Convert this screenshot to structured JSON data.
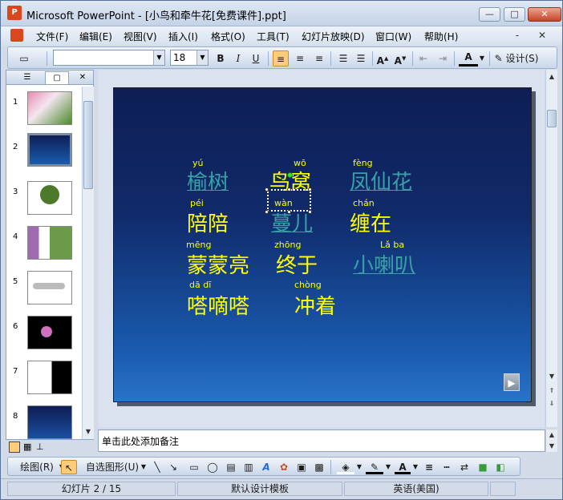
{
  "window": {
    "title": "Microsoft PowerPoint - [小鸟和牵牛花[免费课件].ppt]",
    "min": "—",
    "max": "□",
    "close": "✕"
  },
  "menu": [
    "文件(F)",
    "编辑(E)",
    "视图(V)",
    "插入(I)",
    "格式(O)",
    "工具(T)",
    "幻灯片放映(D)",
    "窗口(W)",
    "帮助(H)"
  ],
  "mdi": "- ✕",
  "toolbar": {
    "font_name": "",
    "font_size": "18",
    "bold": "B",
    "italic": "I",
    "underline": "U",
    "design": "设计(S)",
    "font_color": "A"
  },
  "thumbnails": [
    "1",
    "2",
    "3",
    "4",
    "5",
    "6",
    "7",
    "8"
  ],
  "selected_slide": 2,
  "slide": {
    "words": [
      {
        "text": "榆树",
        "pinyin": "yú",
        "link": true
      },
      {
        "text": "鸟窝",
        "pinyin": "wō",
        "link": false
      },
      {
        "text": "凤仙花",
        "pinyin": "fèng",
        "link": true
      },
      {
        "text": "陪陪",
        "pinyin": "péi",
        "link": false
      },
      {
        "text": "蔓儿",
        "pinyin": "wàn",
        "link": true
      },
      {
        "text": "缠在",
        "pinyin": "chán",
        "link": false
      },
      {
        "text": "蒙蒙亮",
        "pinyin": "mēng",
        "link": false
      },
      {
        "text": "终于",
        "pinyin": "zhōng",
        "link": false
      },
      {
        "text": "小喇叭",
        "pinyin": "Lǎ  ba",
        "link": true
      },
      {
        "text": "嗒嘀嗒",
        "pinyin": "dā  dī",
        "link": false
      },
      {
        "text": "冲着",
        "pinyin": "chòng",
        "link": false
      }
    ],
    "action_button": "▶"
  },
  "notes": "单击此处添加备注",
  "drawbar": {
    "draw": "绘图(R)",
    "autoshapes": "自选图形(U)"
  },
  "status": {
    "slide": "幻灯片 2 / 15",
    "template": "默认设计模板",
    "language": "英语(美国)"
  },
  "colors": {
    "pinyin": "#ffff00",
    "link_word": "#3aa0a8",
    "slide_bg": "#102a6a"
  }
}
